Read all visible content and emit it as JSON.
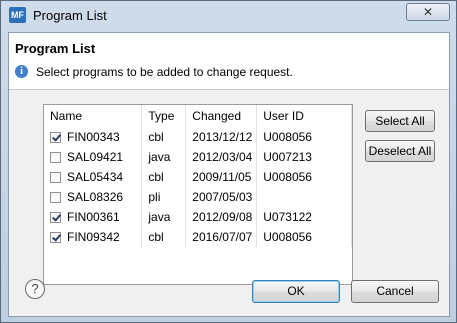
{
  "window": {
    "title": "Program List",
    "app_icon_text": "MF",
    "close_label": "✕"
  },
  "header": {
    "title": "Program List",
    "info_text": "Select programs to be added to change request.",
    "info_icon": "info-icon"
  },
  "table": {
    "columns": [
      "Name",
      "Type",
      "Changed",
      "User ID"
    ],
    "rows": [
      {
        "checked": true,
        "name": "FIN00343",
        "type": "cbl",
        "changed": "2013/12/12",
        "user_id": "U008056"
      },
      {
        "checked": false,
        "name": "SAL09421",
        "type": "java",
        "changed": "2012/03/04",
        "user_id": "U007213"
      },
      {
        "checked": false,
        "name": "SAL05434",
        "type": "cbl",
        "changed": "2009/11/05",
        "user_id": "U008056"
      },
      {
        "checked": false,
        "name": "SAL08326",
        "type": "pli",
        "changed": "2007/05/03",
        "user_id": ""
      },
      {
        "checked": true,
        "name": "FIN00361",
        "type": "java",
        "changed": "2012/09/08",
        "user_id": "U073122"
      },
      {
        "checked": true,
        "name": "FIN09342",
        "type": "cbl",
        "changed": "2016/07/07",
        "user_id": "U008056"
      }
    ]
  },
  "buttons": {
    "select_all": "Select All",
    "deselect_all": "Deselect All",
    "ok": "OK",
    "cancel": "Cancel",
    "help": "?"
  }
}
